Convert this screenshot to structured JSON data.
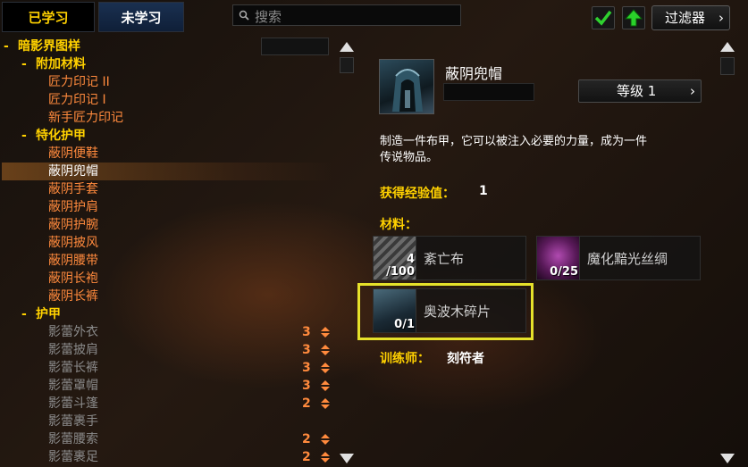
{
  "tabs": {
    "learned": "已学习",
    "unlearned": "未学习"
  },
  "search": {
    "placeholder": "搜索",
    "icon": "search-icon"
  },
  "toolbar": {
    "check_icon": "checkmark-icon",
    "up_icon": "up-arrow-icon",
    "filter_label": "过滤器",
    "filter_chevron": "›"
  },
  "tree": {
    "minus": "-",
    "rows": [
      {
        "label": "暗影界图样",
        "kind": "cat",
        "count": ""
      },
      {
        "label": "附加材料",
        "kind": "sub",
        "count": ""
      },
      {
        "label": "匠力印记 II",
        "kind": "recipe",
        "count": ""
      },
      {
        "label": "匠力印记 I",
        "kind": "recipe",
        "count": ""
      },
      {
        "label": "新手匠力印记",
        "kind": "recipe",
        "count": ""
      },
      {
        "label": "特化护甲",
        "kind": "sub",
        "count": ""
      },
      {
        "label": "蔽阴便鞋",
        "kind": "recipe",
        "count": ""
      },
      {
        "label": "蔽阴兜帽",
        "kind": "recipe-sel",
        "count": ""
      },
      {
        "label": "蔽阴手套",
        "kind": "recipe",
        "count": ""
      },
      {
        "label": "蔽阴护肩",
        "kind": "recipe",
        "count": ""
      },
      {
        "label": "蔽阴护腕",
        "kind": "recipe",
        "count": ""
      },
      {
        "label": "蔽阴披风",
        "kind": "recipe",
        "count": ""
      },
      {
        "label": "蔽阴腰带",
        "kind": "recipe",
        "count": ""
      },
      {
        "label": "蔽阴长袍",
        "kind": "recipe",
        "count": ""
      },
      {
        "label": "蔽阴长裤",
        "kind": "recipe",
        "count": ""
      },
      {
        "label": "护甲",
        "kind": "sub",
        "count": ""
      },
      {
        "label": "影蕾外衣",
        "kind": "recipe-dim",
        "count": "3"
      },
      {
        "label": "影蕾披肩",
        "kind": "recipe-dim",
        "count": "3"
      },
      {
        "label": "影蕾长裤",
        "kind": "recipe-dim",
        "count": "3"
      },
      {
        "label": "影蕾罩帽",
        "kind": "recipe-dim",
        "count": "3"
      },
      {
        "label": "影蕾斗篷",
        "kind": "recipe-dim",
        "count": "2"
      },
      {
        "label": "影蕾裹手",
        "kind": "recipe-dim",
        "count": ""
      },
      {
        "label": "影蕾腰索",
        "kind": "recipe-dim",
        "count": "2"
      },
      {
        "label": "影蕾裹足",
        "kind": "recipe-dim",
        "count": "2"
      }
    ]
  },
  "detail": {
    "item_name": "蔽阴兜帽",
    "rank_label": "等级 1",
    "rank_chevron": "›",
    "description_line1": "制造一件布甲，它可以被注入必要的力量，成为一件",
    "description_line2": "传说物品。",
    "xp_label": "获得经验值：",
    "xp_value": "1",
    "materials_label": "材料：",
    "reagents": [
      {
        "name": "紊亡布",
        "count_top": "4",
        "count_bottom": "/100",
        "icon": "shrouded-cloth-icon"
      },
      {
        "name": "魔化黯光丝绸",
        "count_top": "",
        "count_bottom": "0/25",
        "icon": "enchanted-lightless-silk-icon"
      },
      {
        "name": "奥波木碎片",
        "count_top": "",
        "count_bottom": "0/1",
        "icon": "orboreal-shard-icon"
      }
    ],
    "trainer_label": "训练师：",
    "trainer_value": "刻符者"
  },
  "colors": {
    "gold": "#ffd100",
    "orange": "#ff8a3d",
    "gray": "#8a8a8a",
    "highlight": "#e6e12a"
  }
}
